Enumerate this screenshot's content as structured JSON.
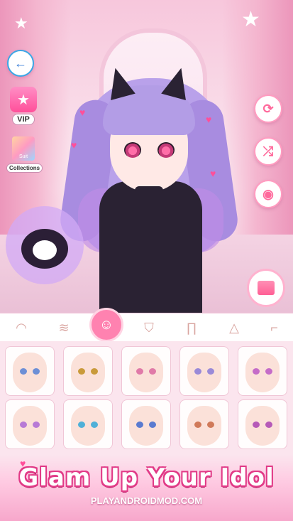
{
  "sidebar": {
    "vip_label": "VIP",
    "suit_label": "Suit",
    "collections_label": "Collections"
  },
  "categories": [
    {
      "name": "face-base",
      "icon": "face-outline-icon",
      "active": false
    },
    {
      "name": "hair",
      "icon": "hair-icon",
      "active": false
    },
    {
      "name": "face",
      "icon": "face-icon",
      "active": true
    },
    {
      "name": "top",
      "icon": "shirt-icon",
      "active": false
    },
    {
      "name": "bottom",
      "icon": "pants-icon",
      "active": false
    },
    {
      "name": "dress",
      "icon": "dress-icon",
      "active": false
    },
    {
      "name": "accessory",
      "icon": "shoe-icon",
      "active": false
    }
  ],
  "face_options": {
    "row1": [
      "#6d8fd6",
      "#c99a3a",
      "#e07aa8",
      "#9a8ad8",
      "#c56cc8"
    ],
    "row2": [
      "#b77ad6",
      "#4fb0d8",
      "#5a7bd0",
      "#d07a5a",
      "#b65ab8"
    ]
  },
  "banner": {
    "title": "Glam Up Your Idol",
    "watermark": "PLAYANDROIDMOD.COM"
  },
  "colors": {
    "accent": "#ff5c98",
    "background": "#fbe5ee"
  }
}
